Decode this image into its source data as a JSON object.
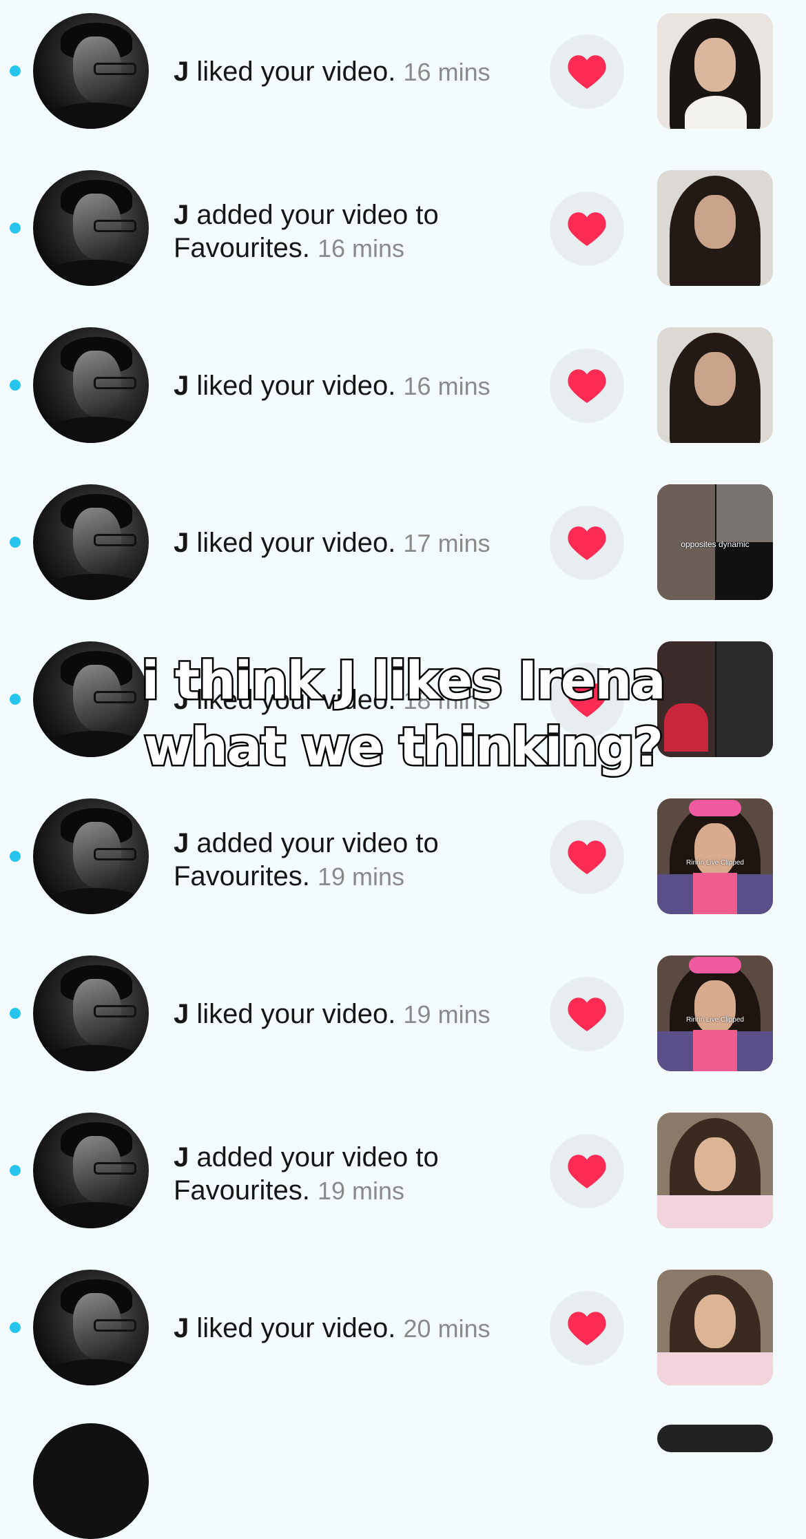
{
  "notifications": [
    {
      "actor": "J",
      "action": " liked your video.",
      "time": "16 mins",
      "thumb": "t1"
    },
    {
      "actor": "J",
      "action": " added your video to Favourites.",
      "time": "16 mins",
      "thumb": "t2"
    },
    {
      "actor": "J",
      "action": " liked your video.",
      "time": "16 mins",
      "thumb": "t3"
    },
    {
      "actor": "J",
      "action": " liked your video.",
      "time": "17 mins",
      "thumb": "t4",
      "thumb_caption": "opposites dynamic"
    },
    {
      "actor": "J",
      "action": " liked your video.",
      "time": "18 mins",
      "thumb": "t5"
    },
    {
      "actor": "J",
      "action": " added your video to Favourites.",
      "time": "19 mins",
      "thumb": "t6",
      "thumb_caption": "Rinrin Live Clipped"
    },
    {
      "actor": "J",
      "action": " liked your video.",
      "time": "19 mins",
      "thumb": "t7",
      "thumb_caption": "Rinrin Live Clipped"
    },
    {
      "actor": "J",
      "action": " added your video to Favourites.",
      "time": "19 mins",
      "thumb": "t8"
    },
    {
      "actor": "J",
      "action": " liked your video.",
      "time": "20 mins",
      "thumb": "t9"
    }
  ],
  "overlay": {
    "line1": "i think J likes Irena",
    "line2": "what we thinking?"
  },
  "icons": {
    "like": "heart-icon",
    "unread": "unread-dot-icon"
  },
  "colors": {
    "background": "#f3fbfd",
    "unread_dot": "#27c4ee",
    "heart": "#fe2c55",
    "time_text": "#8a8a8a"
  }
}
